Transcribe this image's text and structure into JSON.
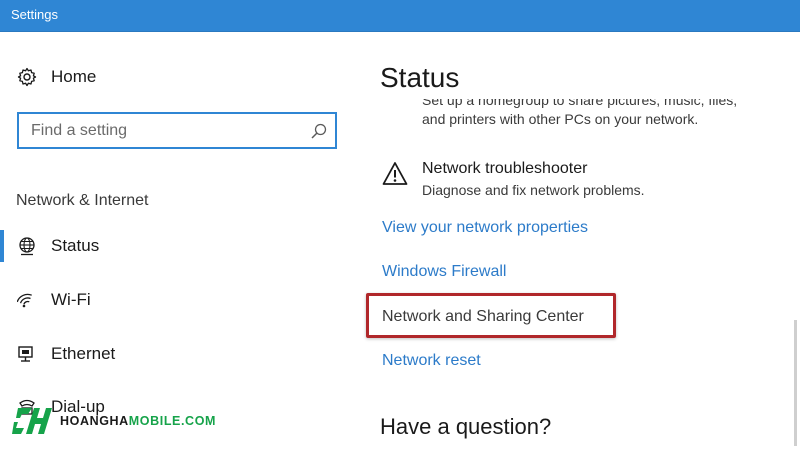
{
  "window": {
    "title": "Settings"
  },
  "sidebar": {
    "home_label": "Home",
    "search_placeholder": "Find a setting",
    "section_label": "Network & Internet",
    "items": [
      {
        "label": "Status",
        "icon": "globe-icon",
        "selected": true
      },
      {
        "label": "Wi-Fi",
        "icon": "wifi-icon",
        "selected": false
      },
      {
        "label": "Ethernet",
        "icon": "ethernet-icon",
        "selected": false
      },
      {
        "label": "Dial-up",
        "icon": "dialup-icon",
        "selected": false
      }
    ]
  },
  "main": {
    "title": "Status",
    "cut_text": "Set up a homegroup to share pictures, music, files,",
    "body_text": "and printers with other PCs on your network.",
    "troubleshooter": {
      "title": "Network troubleshooter",
      "description": "Diagnose and fix network problems.",
      "icon": "warning-icon"
    },
    "links": {
      "view_properties": "View your network properties",
      "windows_firewall": "Windows Firewall",
      "sharing_center": "Network and Sharing Center",
      "network_reset": "Network reset"
    },
    "question_heading": "Have a question?"
  },
  "watermark": {
    "brand_left": "HOANGHA",
    "brand_right": "MOBILE.COM"
  },
  "colors": {
    "accent": "#2f86d4",
    "link": "#2c7bc9",
    "highlight": "#b0272a",
    "brand_green": "#16a34a"
  }
}
